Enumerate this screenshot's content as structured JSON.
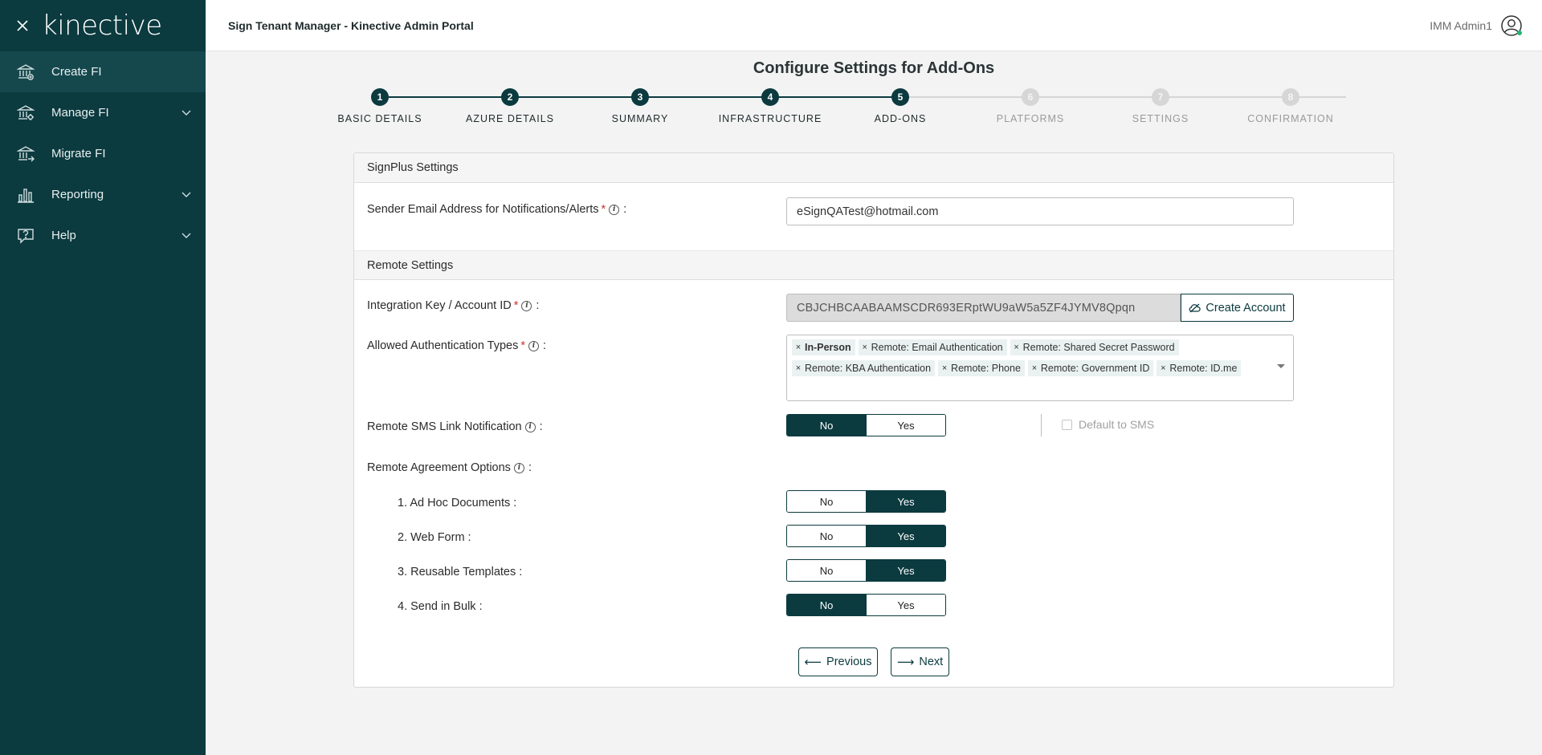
{
  "sidebar": {
    "logo": "kinective",
    "items": [
      {
        "label": "Create FI",
        "icon": "bank-icon",
        "active": true,
        "expandable": false
      },
      {
        "label": "Manage FI",
        "icon": "bank-settings-icon",
        "active": false,
        "expandable": true
      },
      {
        "label": "Migrate FI",
        "icon": "bank-migrate-icon",
        "active": false,
        "expandable": false
      },
      {
        "label": "Reporting",
        "icon": "bar-chart-icon",
        "active": false,
        "expandable": true
      },
      {
        "label": "Help",
        "icon": "help-icon",
        "active": false,
        "expandable": true
      }
    ]
  },
  "header": {
    "title": "Sign Tenant Manager - Kinective Admin Portal",
    "user": "IMM Admin1"
  },
  "page": {
    "title": "Configure Settings for Add-Ons"
  },
  "steps": [
    {
      "num": "1",
      "label": "Basic Details",
      "state": "done"
    },
    {
      "num": "2",
      "label": "Azure Details",
      "state": "done"
    },
    {
      "num": "3",
      "label": "Summary",
      "state": "done"
    },
    {
      "num": "4",
      "label": "Infrastructure",
      "state": "done"
    },
    {
      "num": "5",
      "label": "Add-Ons",
      "state": "current"
    },
    {
      "num": "6",
      "label": "Platforms",
      "state": "todo"
    },
    {
      "num": "7",
      "label": "Settings",
      "state": "todo"
    },
    {
      "num": "8",
      "label": "Confirmation",
      "state": "todo"
    }
  ],
  "signplus": {
    "heading": "SignPlus Settings",
    "sender_label": "Sender Email Address for Notifications/Alerts",
    "sender_value": "eSignQATest@hotmail.com"
  },
  "remote": {
    "heading": "Remote Settings",
    "integration_label": "Integration Key / Account ID",
    "integration_value": "CBJCHBCAABAAMSCDR693ERptWU9aW5a5ZF4JYMV8Qpqn",
    "create_account": "Create Account",
    "auth_label": "Allowed Authentication Types",
    "auth_types": [
      "In-Person",
      "Remote: Email Authentication",
      "Remote: Shared Secret Password",
      "Remote: KBA Authentication",
      "Remote: Phone",
      "Remote: Government ID",
      "Remote: ID.me"
    ],
    "sms_label": "Remote SMS Link Notification",
    "sms_value": "No",
    "default_sms": "Default to SMS",
    "agreement_label": "Remote Agreement Options",
    "options": [
      {
        "label": "1. Ad Hoc Documents :",
        "value": "Yes"
      },
      {
        "label": "2. Web Form :",
        "value": "Yes"
      },
      {
        "label": "3. Reusable Templates :",
        "value": "Yes"
      },
      {
        "label": "4. Send in Bulk :",
        "value": "No"
      }
    ]
  },
  "toggle": {
    "no": "No",
    "yes": "Yes"
  },
  "nav": {
    "previous": "Previous",
    "next": "Next"
  },
  "colors": {
    "brand": "#0b3a3f",
    "required": "#d0312d"
  }
}
